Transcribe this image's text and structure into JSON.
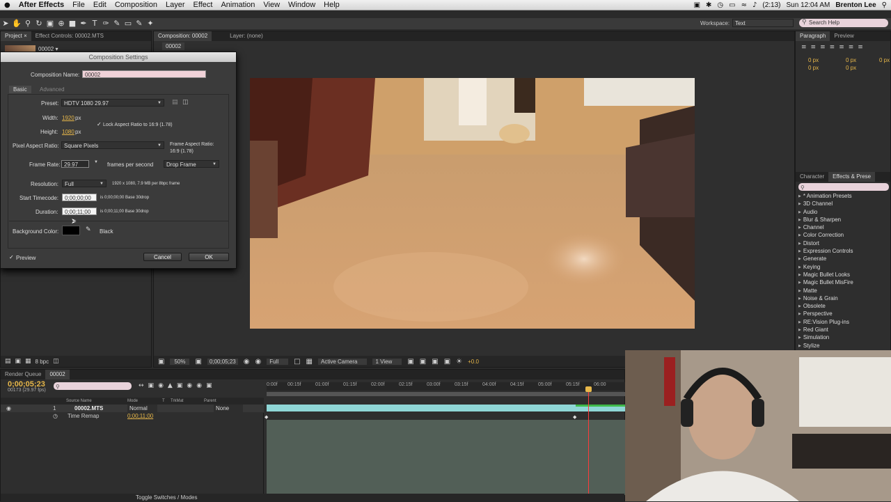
{
  "menubar": {
    "apple": "",
    "app_name": "After Effects",
    "items": [
      "File",
      "Edit",
      "Composition",
      "Layer",
      "Effect",
      "Animation",
      "View",
      "Window",
      "Help"
    ],
    "battery": "(2:13)",
    "clock": "Sun 12:04 AM",
    "user": "Brenton Lee"
  },
  "toolbar": {
    "workspace_label": "Workspace:",
    "workspace_value": "Text",
    "search_placeholder": "Search Help"
  },
  "project_panel": {
    "tabs": [
      "Project ×",
      "Effect Controls: 00002.MTS"
    ],
    "item_name": "00002 ▾",
    "bpc": "8 bpc"
  },
  "dialog": {
    "title": "Composition Settings",
    "comp_name_label": "Composition Name:",
    "comp_name_value": "00002",
    "tab_basic": "Basic",
    "tab_advanced": "Advanced",
    "preset_label": "Preset:",
    "preset_value": "HDTV 1080 29.97",
    "width_label": "Width:",
    "width_value": "1920",
    "height_label": "Height:",
    "height_value": "1080",
    "px": "px",
    "lock_aspect": "Lock Aspect Ratio to 16:9 (1.78)",
    "par_label": "Pixel Aspect Ratio:",
    "par_value": "Square Pixels",
    "frame_aspect_label": "Frame Aspect Ratio:",
    "frame_aspect_value": "16:9 (1.78)",
    "frame_rate_label": "Frame Rate:",
    "frame_rate_value": "29.97",
    "fps_text": "frames per second",
    "drop_frame": "Drop Frame",
    "resolution_label": "Resolution:",
    "resolution_value": "Full",
    "resolution_info": "1920 x 1080, 7.9 MB per 8bpc frame",
    "start_tc_label": "Start Timecode:",
    "start_tc_value": "0;00;00;00",
    "start_tc_info": "is 0;00;00;00  Base 30drop",
    "duration_label": "Duration:",
    "duration_value": "0;00;11;00",
    "duration_info": "is 0;00;11;00  Base 30drop",
    "bg_label": "Background Color:",
    "bg_name": "Black",
    "preview": "Preview",
    "cancel": "Cancel",
    "ok": "OK"
  },
  "viewer": {
    "tab_comp": "Composition: 00002",
    "tab_layer": "Layer: (none)",
    "crumb": "00002",
    "zoom": "50%",
    "timecode": "0;00;05;23",
    "resolution": "Full",
    "camera": "Active Camera",
    "views": "1 View",
    "exposure": "+0.0"
  },
  "right_panel": {
    "paragraph_tab": "Paragraph",
    "preview_tab": "Preview",
    "px_values": [
      "0 px",
      "0 px",
      "0 px",
      "0 px",
      "0 px"
    ],
    "character_tab": "Character",
    "effects_tab": "Effects & Prese",
    "effects": [
      "* Animation Presets",
      "3D Channel",
      "Audio",
      "Blur & Sharpen",
      "Channel",
      "Color Correction",
      "Distort",
      "Expression Controls",
      "Generate",
      "Keying",
      "Magic Bullet Looks",
      "Magic Bullet MisFire",
      "Matte",
      "Noise & Grain",
      "Obsolete",
      "Perspective",
      "RE:Vision Plug-ins",
      "Red Giant",
      "Simulation",
      "Stylize"
    ]
  },
  "timeline": {
    "tab_render": "Render Queue",
    "tab_comp": "00002",
    "current_time": "0;00;05;23",
    "frame_info": "00173 (29.97 fps)",
    "col_source": "Source Name",
    "col_mode": "Mode",
    "col_t": "T",
    "col_trkmat": "TrkMat",
    "col_parent": "Parent",
    "layer_num": "1",
    "layer_name": "00002.MTS",
    "layer_mode": "Normal",
    "layer_parent": "None",
    "time_remap_label": "Time Remap",
    "time_remap_value": "0;00;11;00",
    "ruler": [
      "0:00f",
      "00:15f",
      "01:00f",
      "01:15f",
      "02:00f",
      "02:15f",
      "03:00f",
      "03:15f",
      "04:00f",
      "04:15f",
      "05:00f",
      "05:15f",
      "06:00"
    ],
    "toggle": "Toggle Switches / Modes"
  }
}
